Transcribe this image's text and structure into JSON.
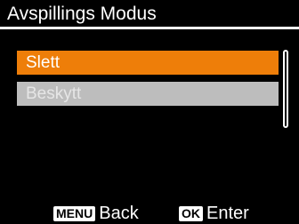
{
  "header": {
    "title": "Avspillings Modus"
  },
  "menu": {
    "items": [
      {
        "label": "Slett",
        "state": "selected"
      },
      {
        "label": "Beskytt",
        "state": "disabled"
      }
    ]
  },
  "footer": {
    "back": {
      "key": "MENU",
      "label": "Back"
    },
    "enter": {
      "key": "OK",
      "label": "Enter"
    }
  },
  "colors": {
    "selected": "#ee7e09",
    "disabled": "#bdbdbd",
    "background": "#000000"
  }
}
